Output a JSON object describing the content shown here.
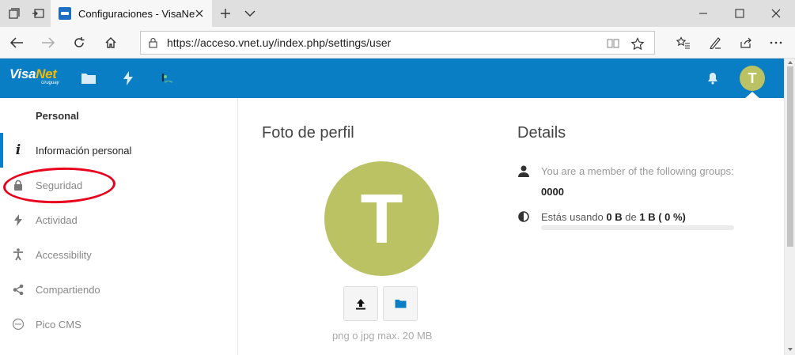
{
  "browser": {
    "tab_title": "Configuraciones - VisaNet",
    "url": "https://acceso.vnet.uy/index.php/settings/user"
  },
  "header": {
    "logo_visa": "Visa",
    "logo_net": "Net",
    "logo_sub": "Uruguay",
    "avatar_initial": "T"
  },
  "nav": {
    "section_title": "Personal",
    "items": [
      {
        "label": "Información personal",
        "icon": "info-icon",
        "active": true
      },
      {
        "label": "Seguridad",
        "icon": "lock-icon"
      },
      {
        "label": "Actividad",
        "icon": "bolt-icon"
      },
      {
        "label": "Accessibility",
        "icon": "accessibility-icon"
      },
      {
        "label": "Compartiendo",
        "icon": "share-icon"
      },
      {
        "label": "Pico CMS",
        "icon": "pico-icon"
      }
    ]
  },
  "profile": {
    "title": "Foto de perfil",
    "avatar_initial": "T",
    "hint": "png o jpg max. 20 MB"
  },
  "details": {
    "title": "Details",
    "groups_text": "You are a member of the following groups:",
    "groups_value": "0000",
    "usage_prefix": "Estás usando",
    "usage_used": "0 B",
    "usage_mid": "de",
    "usage_total": "1 B",
    "usage_percent": "( 0 %)",
    "usage_fraction": 0
  },
  "colors": {
    "brand_blue": "#0a7ec4",
    "avatar_green": "#bbc264",
    "annotation_red": "#e8001c"
  }
}
